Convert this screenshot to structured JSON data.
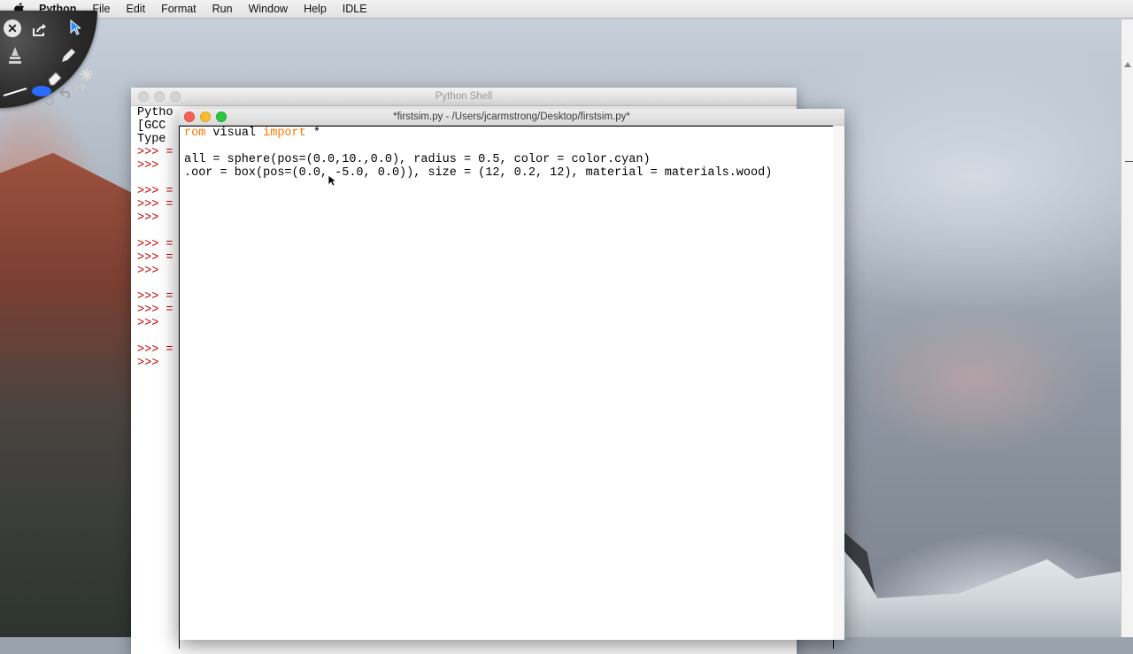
{
  "menubar": {
    "app_name": "Python",
    "items": [
      "File",
      "Edit",
      "Format",
      "Run",
      "Window",
      "Help",
      "IDLE"
    ]
  },
  "shell": {
    "title": "Python Shell",
    "lines": [
      {
        "text": "Pytho"
      },
      {
        "text": "[GCC "
      },
      {
        "text": "Type "
      },
      {
        "prompt": ">>> ",
        "text": "="
      },
      {
        "prompt": ">>> ",
        "text": ""
      },
      {
        "text": ""
      },
      {
        "prompt": ">>> ",
        "text": "="
      },
      {
        "prompt": ">>> ",
        "text": "="
      },
      {
        "prompt": ">>> ",
        "text": ""
      },
      {
        "text": ""
      },
      {
        "prompt": ">>> ",
        "text": "="
      },
      {
        "prompt": ">>> ",
        "text": "="
      },
      {
        "prompt": ">>> ",
        "text": ""
      },
      {
        "text": ""
      },
      {
        "prompt": ">>> ",
        "text": "="
      },
      {
        "prompt": ">>> ",
        "text": "="
      },
      {
        "prompt": ">>> ",
        "text": ""
      },
      {
        "text": ""
      },
      {
        "prompt": ">>> ",
        "text": "="
      },
      {
        "prompt": ">>> ",
        "text": ""
      }
    ]
  },
  "editor": {
    "title": "*firstsim.py - /Users/jcarmstrong/Desktop/firstsim.py*",
    "code": [
      [
        {
          "t": "rom",
          "k": true
        },
        {
          "t": " visual "
        },
        {
          "t": "import",
          "k": true
        },
        {
          "t": " *"
        }
      ],
      [],
      [
        {
          "t": "all = sphere(pos=(0.0,10.,0.0), radius = 0.5, color = color.cyan)"
        }
      ],
      [
        {
          "t": ".oor = box(pos=(0.0, -5.0, 0.0)), size = (12, 0.2, 12), material = materials.wood)"
        }
      ]
    ]
  },
  "colors": {
    "keyword": "#ff7700",
    "prompt": "#c00000"
  }
}
